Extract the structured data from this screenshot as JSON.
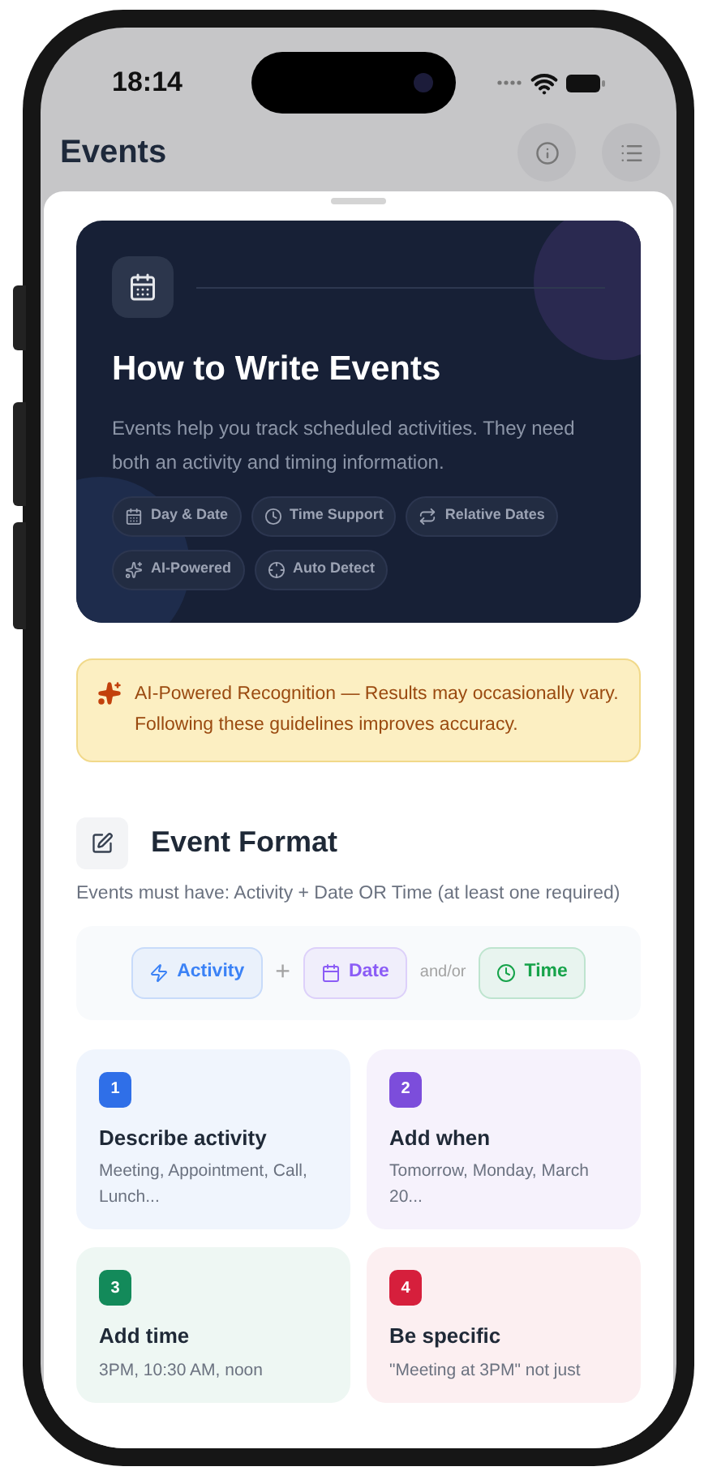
{
  "status_bar": {
    "time": "18:14"
  },
  "nav": {
    "title": "Events"
  },
  "hero": {
    "title": "How to Write Events",
    "description": "Events help you track scheduled activities. They need both an activity and timing information.",
    "features": [
      {
        "label": "Day & Date"
      },
      {
        "label": "Time Support"
      },
      {
        "label": "Relative Dates"
      },
      {
        "label": "AI-Powered"
      },
      {
        "label": "Auto Detect"
      }
    ]
  },
  "notice": {
    "text": "AI-Powered Recognition — Results may occasionally vary. Following these guidelines improves accuracy."
  },
  "format": {
    "title": "Event Format",
    "description": "Events must have: Activity + Date OR Time (at least one required)",
    "parts": [
      {
        "kind": "chip",
        "label": "Activity",
        "color": "#3b82f6"
      },
      {
        "kind": "operator",
        "label": "+"
      },
      {
        "kind": "chip",
        "label": "Date",
        "color": "#8b5cf6"
      },
      {
        "kind": "connector",
        "label": "and/or"
      },
      {
        "kind": "chip",
        "label": "Time",
        "color": "#16a34a"
      }
    ]
  },
  "steps": [
    {
      "number": "1",
      "title": "Describe activity",
      "description": "Meeting, Appointment, Call, Lunch...",
      "color": "#2f6fe8"
    },
    {
      "number": "2",
      "title": "Add when",
      "description": "Tomorrow, Monday, March 20...",
      "color": "#7c4ddb"
    },
    {
      "number": "3",
      "title": "Add time",
      "description": "3PM, 10:30 AM, noon",
      "color": "#138a5a"
    },
    {
      "number": "4",
      "title": "Be specific",
      "description": "\"Meeting at 3PM\" not just",
      "color": "#d61f3c"
    }
  ]
}
